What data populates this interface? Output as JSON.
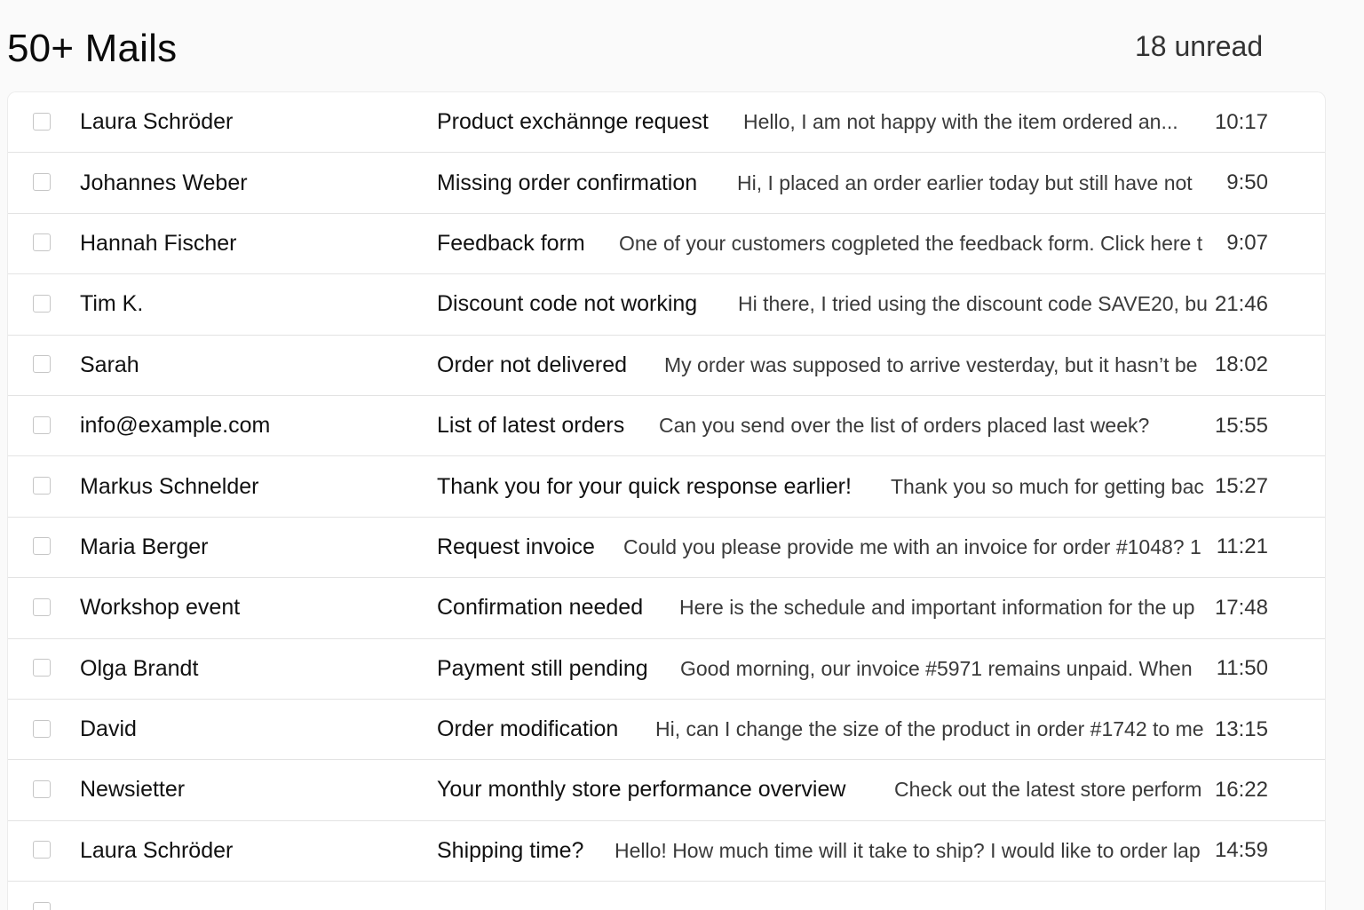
{
  "header": {
    "title": "50+ Mails",
    "unread": "18 unread"
  },
  "mails": [
    {
      "sender": "Laura Schröder",
      "subject": "Product exchännge request",
      "preview": "Hello, I am not happy with the item ordered an...",
      "time": "10:17"
    },
    {
      "sender": "Johannes Weber",
      "subject": "Missing order confirmation",
      "preview": "Hi, I placed an order earlier today but still have not",
      "time": "9:50"
    },
    {
      "sender": "Hannah Fischer",
      "subject": "Feedback form",
      "preview": "One of your customers cogpleted the feedback form. Click here t",
      "time": "9:07"
    },
    {
      "sender": "Tim K.",
      "subject": "Discount code not working",
      "preview": "Hi there, I tried using the discount code SAVE20, bu",
      "time": "21:46"
    },
    {
      "sender": "Sarah",
      "subject": "Order not delivered",
      "preview": "My order was supposed to arrive vesterday, but it hasn’t be",
      "time": "18:02"
    },
    {
      "sender": "info@example.com",
      "subject": "List of latest orders",
      "preview": "Can you send over the list of orders placed last week?",
      "time": "15:55"
    },
    {
      "sender": "Markus Schnelder",
      "subject": "Thank you for your quick response earlier!",
      "preview": "Thank you so much for getting bac",
      "time": "15:27"
    },
    {
      "sender": "Maria Berger",
      "subject": "Request invoice",
      "preview": "Could you please provide me with an invoice for order #1048? 1",
      "time": "11:21"
    },
    {
      "sender": "Workshop event",
      "subject": "Confirmation needed",
      "preview": "Here is the schedule and important information for the up",
      "time": "17:48"
    },
    {
      "sender": "Olga Brandt",
      "subject": "Payment still pending",
      "preview": "Good morning, our invoice #5971 remains unpaid. When",
      "time": "11:50"
    },
    {
      "sender": "David",
      "subject": "Order modification",
      "preview": "Hi, can I change the size of the product in order #1742 to me",
      "time": "13:15"
    },
    {
      "sender": "Newsietter",
      "subject": "Your monthly store performance overview",
      "preview": "Check out the latest store perform",
      "time": "16:22"
    },
    {
      "sender": "Laura Schröder",
      "subject": "Shipping time?",
      "preview": "Hello! How much time will it take to ship? I would like to order lap",
      "time": "14:59"
    }
  ]
}
